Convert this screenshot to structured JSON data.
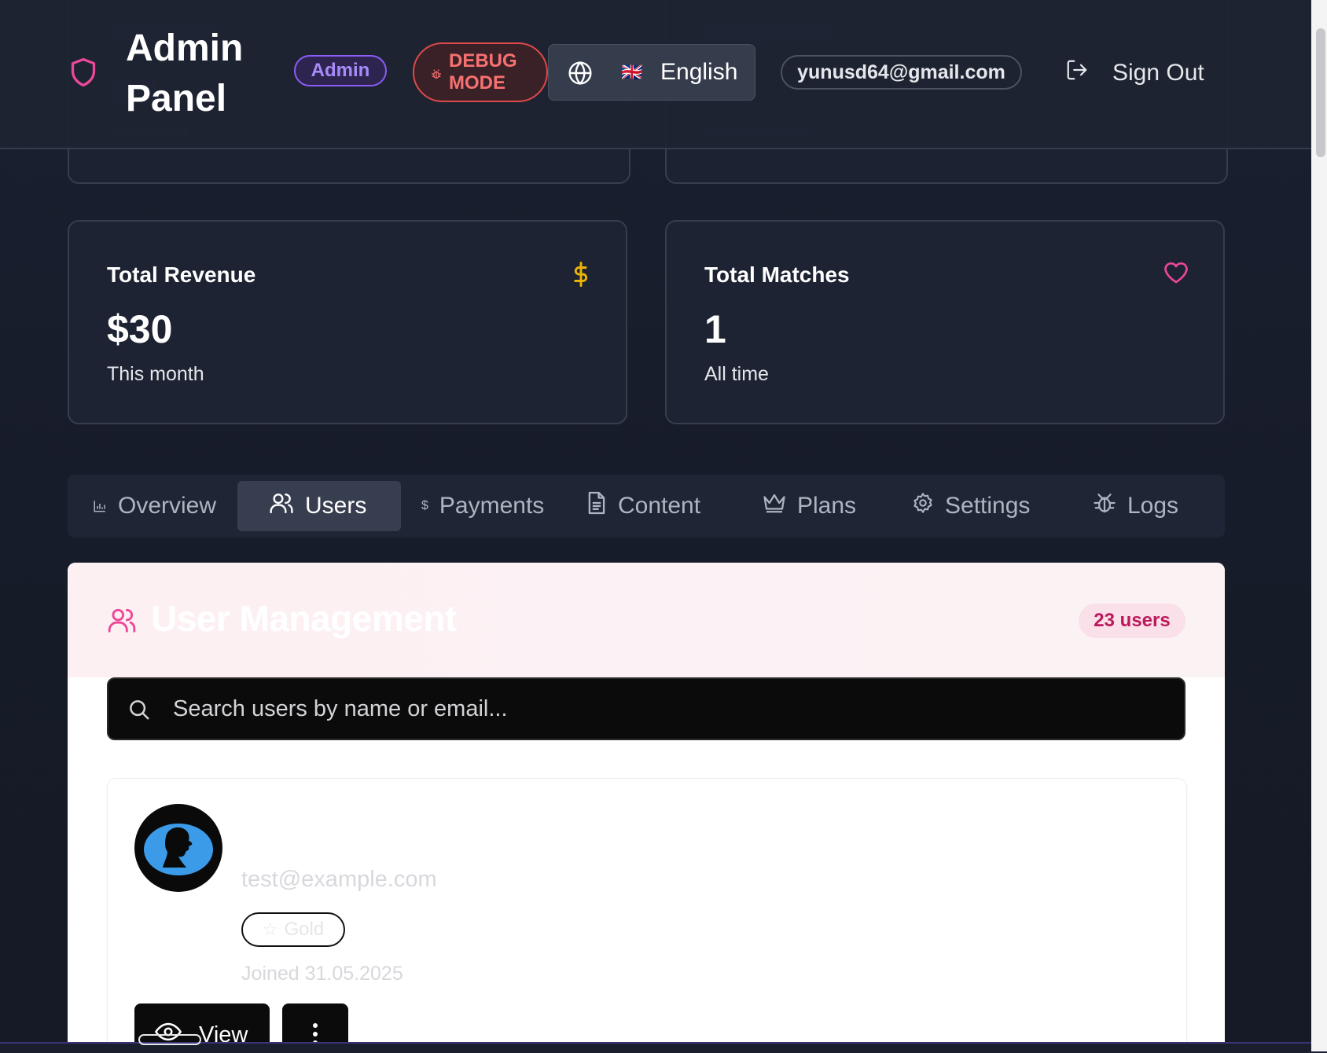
{
  "header": {
    "title": "Admin Panel",
    "role_badge": "Admin",
    "debug_badge": "DEBUG MODE",
    "language": {
      "flag": "🇬🇧",
      "label": "English"
    },
    "user_email": "yunusd64@gmail.com",
    "sign_out_label": "Sign Out"
  },
  "stats": [
    {
      "title": "Total Revenue",
      "value": "$30",
      "subtitle": "This month",
      "icon": "dollar-icon",
      "icon_color": "#eab308"
    },
    {
      "title": "Total Matches",
      "value": "1",
      "subtitle": "All time",
      "icon": "heart-icon",
      "icon_color": "#ec4899"
    }
  ],
  "tabs": [
    {
      "label": "Overview",
      "icon": "bar-chart-icon"
    },
    {
      "label": "Users",
      "icon": "users-icon",
      "active": true
    },
    {
      "label": "Payments",
      "icon": "dollar-icon"
    },
    {
      "label": "Content",
      "icon": "document-icon"
    },
    {
      "label": "Plans",
      "icon": "crown-icon"
    },
    {
      "label": "Settings",
      "icon": "gear-icon"
    },
    {
      "label": "Logs",
      "icon": "bug-icon"
    }
  ],
  "user_management": {
    "title": "User Management",
    "count_badge": "23 users",
    "search_placeholder": "Search users by name or email...",
    "users": [
      {
        "email": "test@example.com",
        "plan": "Gold",
        "joined": "Joined 31.05.2025",
        "view_label": "View"
      }
    ]
  },
  "colors": {
    "accent_pink": "#ec4899",
    "admin_purple": "#8b5cf6",
    "debug_red": "#ef4444"
  }
}
